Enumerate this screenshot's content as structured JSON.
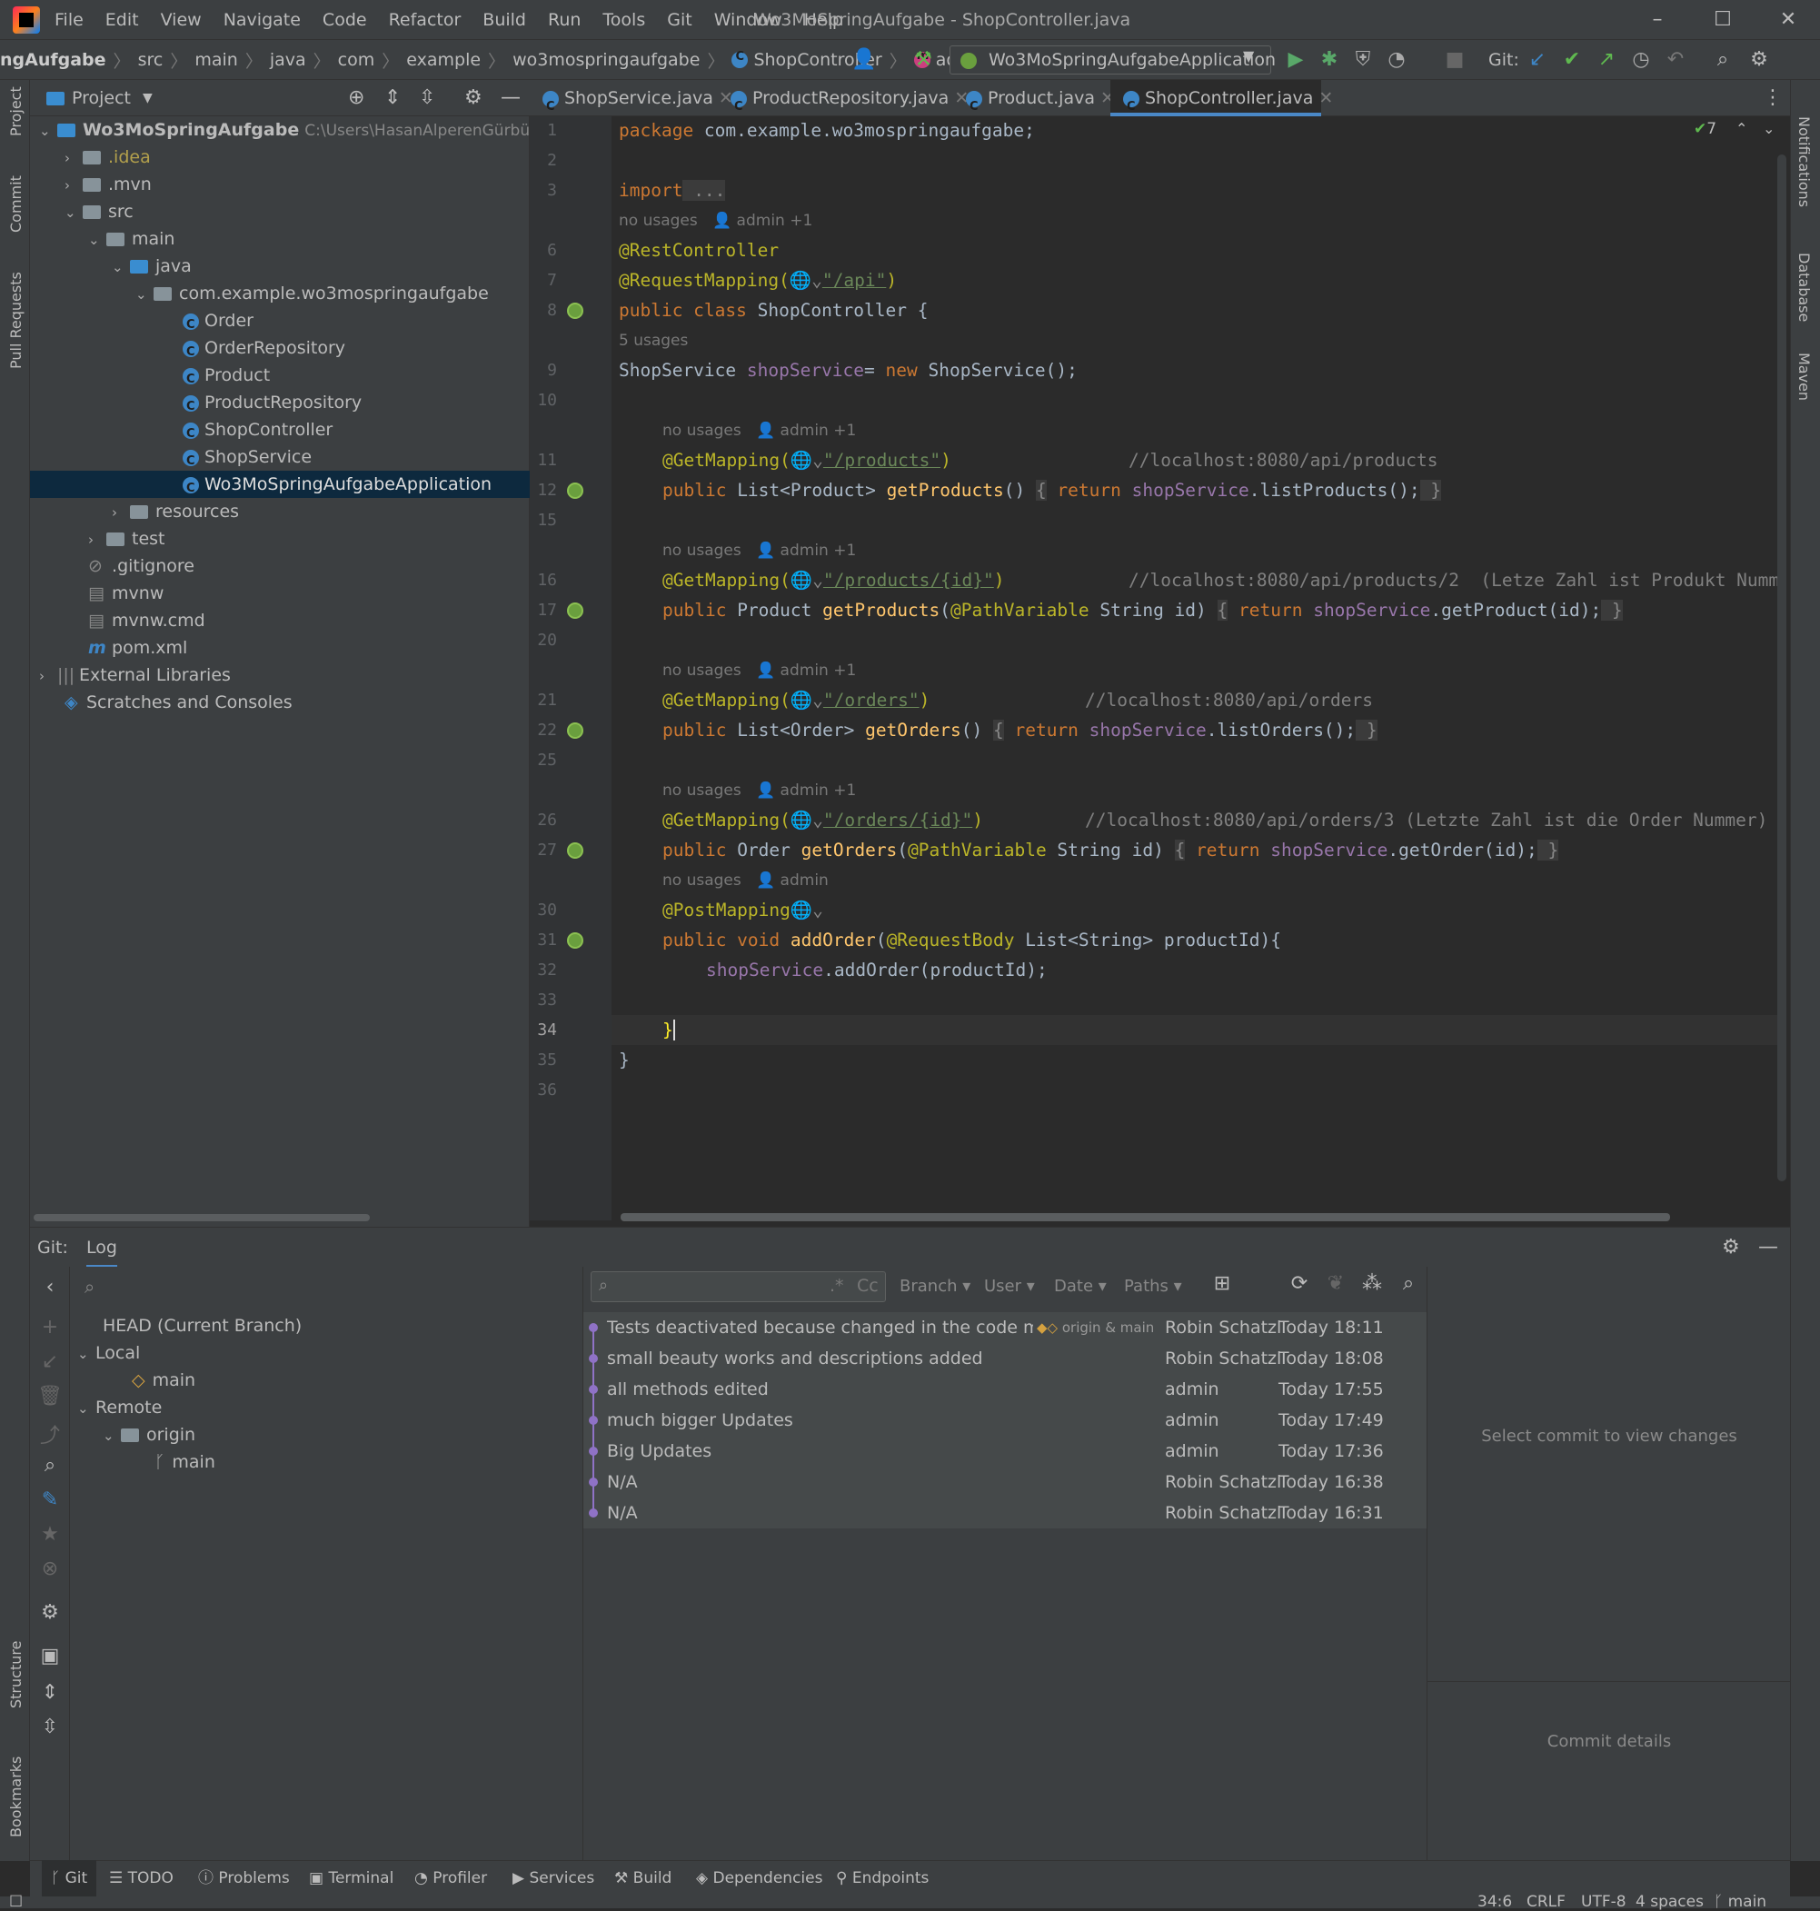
{
  "window": {
    "title": "Wo3MoSpringAufgabe - ShopController.java"
  },
  "menu": [
    "File",
    "Edit",
    "View",
    "Navigate",
    "Code",
    "Refactor",
    "Build",
    "Run",
    "Tools",
    "Git",
    "Window",
    "Help"
  ],
  "breadcrumbs": [
    "ngAufgabe",
    "src",
    "main",
    "java",
    "com",
    "example",
    "wo3mospringaufgabe",
    "ShopController",
    "addOrder"
  ],
  "toolbar": {
    "run_config": "Wo3MoSpringAufgabeApplication",
    "git_label": "Git:"
  },
  "left_strip": [
    "Project",
    "Commit",
    "Pull Requests",
    "Structure",
    "Bookmarks"
  ],
  "right_strip": [
    "Notifications",
    "Database",
    "Maven"
  ],
  "project": {
    "header": "Project",
    "root_name": "Wo3MoSpringAufgabe",
    "root_path": "C:\\Users\\HasanAlperenGürbüz\\Idea",
    "items": [
      ".idea",
      ".mvn",
      "src",
      "main",
      "java",
      "com.example.wo3mospringaufgabe",
      "Order",
      "OrderRepository",
      "Product",
      "ProductRepository",
      "ShopController",
      "ShopService",
      "Wo3MoSpringAufgabeApplication",
      "resources",
      "test",
      ".gitignore",
      "mvnw",
      "mvnw.cmd",
      "pom.xml",
      "External Libraries",
      "Scratches and Consoles"
    ]
  },
  "tabs": [
    "ShopService.java",
    "ProductRepository.java",
    "Product.java",
    "ShopController.java"
  ],
  "editor": {
    "problems_count": "7",
    "line_numbers": [
      "1",
      "2",
      "3",
      "6",
      "7",
      "8",
      "9",
      "10",
      "11",
      "12",
      "15",
      "16",
      "17",
      "20",
      "21",
      "22",
      "25",
      "26",
      "27",
      "30",
      "31",
      "32",
      "33",
      "34",
      "35",
      "36"
    ],
    "hints": {
      "no_usages_admin1": "no usages",
      "admin1": "admin +1",
      "five_usages": "5 usages",
      "admin": "admin"
    },
    "code": {
      "l1_kw": "package",
      "l1_rest": " com.example.wo3mospringaufgabe;",
      "l3_kw": "import",
      "l3_fold": " ...",
      "l6": "@RestController",
      "l7_an": "@RequestMapping(",
      "l7_str": "\"/api\"",
      "l7_end": ")",
      "l8_kw": "public class",
      "l8_rest": " ShopController {",
      "l9_a": "ShopService ",
      "l9_f": "shopService",
      "l9_b": "= ",
      "l9_kw": "new",
      "l9_c": " ShopService();",
      "l11_an": "@GetMapping(",
      "l11_str": "\"/products\"",
      "l11_end": ")",
      "l11_cm": "//localhost:8080/api/products",
      "l12_kw": "public",
      "l12_a": " List<Product> ",
      "l12_fn": "getProducts",
      "l12_b": "() ",
      "l12_fo": "{",
      "l12_ret": " return ",
      "l12_f": "shopService",
      "l12_c": ".listProducts();",
      "l12_fc": " }",
      "l16_an": "@GetMapping(",
      "l16_str": "\"/products/{id}\"",
      "l16_end": ")",
      "l16_cm": "//localhost:8080/api/products/2  (Letze Zahl ist Produkt Numm",
      "l17_kw": "public",
      "l17_a": " Product ",
      "l17_fn": "getProducts",
      "l17_b": "(",
      "l17_an": "@PathVariable",
      "l17_c": " String id) ",
      "l17_fo": "{",
      "l17_ret": " return ",
      "l17_f": "shopService",
      "l17_d": ".getProduct(id);",
      "l17_fc": " }",
      "l21_an": "@GetMapping(",
      "l21_str": "\"/orders\"",
      "l21_end": ")",
      "l21_cm": "//localhost:8080/api/orders",
      "l22_kw": "public",
      "l22_a": " List<Order> ",
      "l22_fn": "getOrders",
      "l22_b": "() ",
      "l22_fo": "{",
      "l22_ret": " return ",
      "l22_f": "shopService",
      "l22_c": ".listOrders();",
      "l22_fc": " }",
      "l26_an": "@GetMapping(",
      "l26_str": "\"/orders/{id}\"",
      "l26_end": ")",
      "l26_cm": "//localhost:8080/api/orders/3 (Letzte Zahl ist die Order Nummer)",
      "l27_kw": "public",
      "l27_a": " Order ",
      "l27_fn": "getOrders",
      "l27_b": "(",
      "l27_an": "@PathVariable",
      "l27_c": " String id) ",
      "l27_fo": "{",
      "l27_ret": " return ",
      "l27_f": "shopService",
      "l27_d": ".getOrder(id);",
      "l27_fc": " }",
      "l30": "@PostMapping",
      "l31_kw": "public void",
      "l31_fn": " addOrder",
      "l31_a": "(",
      "l31_an": "@RequestBody",
      "l31_b": " List<String> productId){",
      "l32_f": "shopService",
      "l32_a": ".addOrder(productId);",
      "l34": "}",
      "l35": "}"
    }
  },
  "git": {
    "label": "Git:",
    "tab": "Log",
    "branches": {
      "head": "HEAD (Current Branch)",
      "local": "Local",
      "local_main": "main",
      "remote": "Remote",
      "origin": "origin",
      "origin_main": "main"
    },
    "filters": [
      "Branch",
      "User",
      "Date",
      "Paths"
    ],
    "commits": [
      {
        "message": "Tests deactivated because changed in the code must be re",
        "tag": "origin & main",
        "author": "Robin Schatzl",
        "date": "Today 18:11"
      },
      {
        "message": "small beauty works and descriptions added",
        "author": "Robin Schatzl",
        "date": "Today 18:08"
      },
      {
        "message": "all methods edited",
        "author": "admin",
        "date": "Today 17:55"
      },
      {
        "message": "much bigger Updates",
        "author": "admin",
        "date": "Today 17:49"
      },
      {
        "message": "Big Updates",
        "author": "admin",
        "date": "Today 17:36"
      },
      {
        "message": "N/A",
        "author": "Robin Schatzl",
        "date": "Today 16:38"
      },
      {
        "message": "N/A",
        "author": "Robin Schatzl",
        "date": "Today 16:31"
      }
    ],
    "select_commit": "Select commit to view changes",
    "commit_details": "Commit details"
  },
  "bottom_tools": [
    "Git",
    "TODO",
    "Problems",
    "Terminal",
    "Profiler",
    "Services",
    "Build",
    "Dependencies",
    "Endpoints"
  ],
  "status": {
    "position": "34:6",
    "line_sep": "CRLF",
    "encoding": "UTF-8",
    "indent": "4 spaces",
    "branch": "main"
  }
}
